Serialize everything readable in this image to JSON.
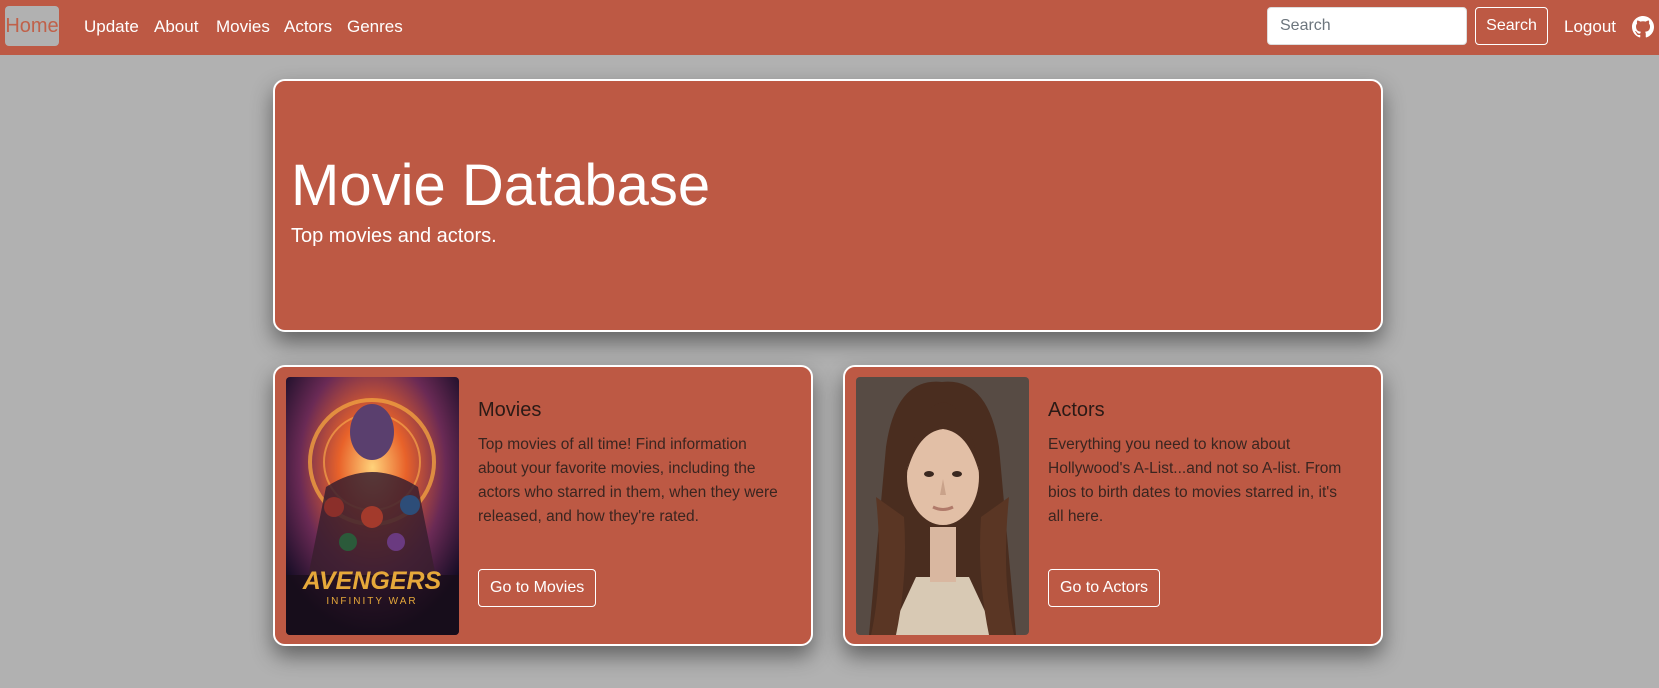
{
  "nav": {
    "home": "Home",
    "links": [
      "Update",
      "About",
      "Movies",
      "Actors",
      "Genres"
    ],
    "search_placeholder": "Search",
    "search_button": "Search",
    "logout": "Logout",
    "github_icon": "github-icon"
  },
  "hero": {
    "title": "Movie Database",
    "subtitle": "Top movies and actors."
  },
  "cards": [
    {
      "title": "Movies",
      "text": "Top movies of all time! Find information about your favorite movies, including the actors who starred in them, when they were released, and how they're rated.",
      "button": "Go to Movies",
      "image_alt": "Avengers Infinity War poster",
      "poster_title": "AVENGERS",
      "poster_subtitle": "INFINITY WAR"
    },
    {
      "title": "Actors",
      "text": "Everything you need to know about Hollywood's A-List...and not so A-list. From bios to birth dates to movies starred in, it's all here.",
      "button": "Go to Actors",
      "image_alt": "Portrait of a young woman"
    }
  ],
  "colors": {
    "accent": "#bd5944",
    "page_bg": "#b1b1b1",
    "border": "#ffffff"
  }
}
